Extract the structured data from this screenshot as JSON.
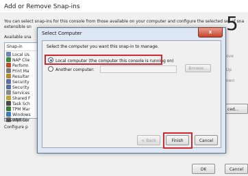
{
  "outer": {
    "title": "Add or Remove Snap-ins",
    "description_line1": "You can select snap-ins for this console from those available on your computer and configure the selected set of snap-in",
    "description_line2": "extensible sn",
    "available_label": "Available sna",
    "list_header": "Snap-in",
    "snapins": [
      {
        "label": "Local Us",
        "color": "#6c88b5"
      },
      {
        "label": "NAP Clie",
        "color": "#3b8a3d"
      },
      {
        "label": "Perform",
        "color": "#c24b2b"
      },
      {
        "label": "Print Ma",
        "color": "#7a7a7a"
      },
      {
        "label": "Resultar",
        "color": "#b58a2c"
      },
      {
        "label": "Security",
        "color": "#5a6ea8"
      },
      {
        "label": "Security",
        "color": "#5a6ea8"
      },
      {
        "label": "Services",
        "color": "#8a8a8a"
      },
      {
        "label": "Shared F",
        "color": "#c2a53a"
      },
      {
        "label": "Task Sch",
        "color": "#4a4a4a"
      },
      {
        "label": "TPM Mar",
        "color": "#3a7a3a"
      },
      {
        "label": "Windows",
        "color": "#3a7ac2"
      },
      {
        "label": "WMI Cor",
        "color": "#6a6a6a"
      }
    ],
    "right_buttons": [
      "ove",
      "Up",
      "own"
    ],
    "advanced_label": "ced...",
    "description_label": "Description:",
    "description_text": "Configure p",
    "ok_label": "OK",
    "cancel_label": "Cancel",
    "step_number": "5"
  },
  "dialog": {
    "title": "Select Computer",
    "close_label": "x",
    "prompt": "Select the computer you want this snap-in to manage.",
    "option_local": "Local computer (the computer this console is running on)",
    "option_another": "Another computer:",
    "another_computer_value": "",
    "browse_label": "Browse...",
    "back_label": "< Back",
    "finish_label": "Finish",
    "cancel_label": "Cancel"
  }
}
